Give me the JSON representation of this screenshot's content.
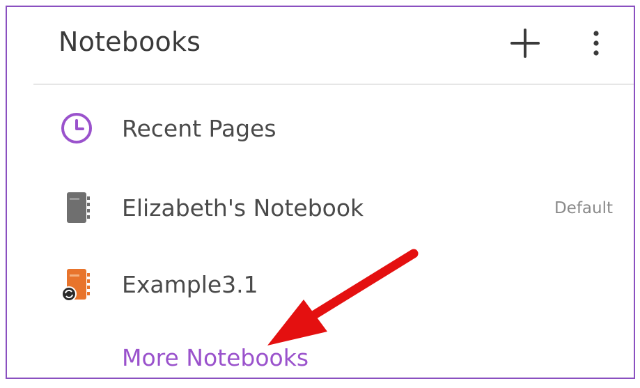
{
  "header": {
    "title": "Notebooks",
    "add_icon": "plus-icon",
    "more_icon": "more-vertical-icon"
  },
  "items": [
    {
      "label": "Recent Pages",
      "icon": "clock-icon",
      "badge": ""
    },
    {
      "label": "Elizabeth's Notebook",
      "icon": "notebook-icon",
      "badge": "Default"
    },
    {
      "label": "Example3.1",
      "icon": "notebook-sync-icon",
      "badge": ""
    }
  ],
  "more_link": "More Notebooks",
  "colors": {
    "frame_border": "#8a50c0",
    "accent_purple": "#9a52cc",
    "notebook_gray": "#6f6f6f",
    "notebook_orange": "#e8742c",
    "annotation_arrow": "#e41010"
  }
}
